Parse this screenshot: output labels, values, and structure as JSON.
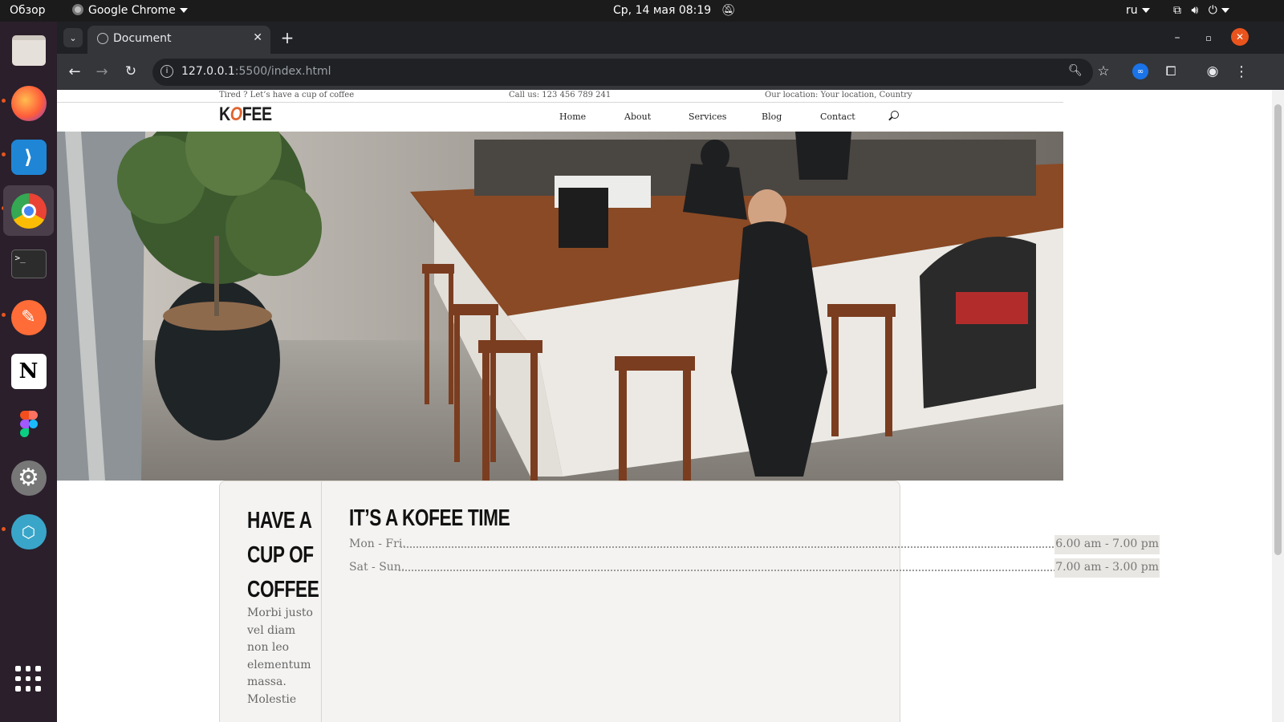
{
  "system": {
    "activities": "Обзор",
    "app_name": "Google Chrome",
    "datetime": "Ср, 14 мая  08:19",
    "lang": "ru"
  },
  "browser": {
    "tab_title": "Document",
    "url_host": "127.0.0.1",
    "url_rest": ":5500/index.html"
  },
  "dock": [
    {
      "name": "files",
      "icon": "folder-icon"
    },
    {
      "name": "firefox",
      "icon": "firefox-icon"
    },
    {
      "name": "vscode",
      "icon": "vscode-icon"
    },
    {
      "name": "chrome",
      "icon": "chrome-icon"
    },
    {
      "name": "terminal",
      "icon": "terminal-icon"
    },
    {
      "name": "postman",
      "icon": "postman-icon"
    },
    {
      "name": "notion",
      "icon": "notion-icon"
    },
    {
      "name": "figma",
      "icon": "figma-icon"
    },
    {
      "name": "settings",
      "icon": "gear-icon"
    },
    {
      "name": "software",
      "icon": "software-icon"
    }
  ],
  "site": {
    "info": {
      "tagline": "Tired ? Let’s have a cup of coffee",
      "phone": "Call us: 123 456 789 241",
      "location": "Our location: Your location, Country"
    },
    "logo": {
      "before": "K",
      "o": "O",
      "after": "FEE"
    },
    "nav": [
      "Home",
      "About",
      "Services",
      "Blog",
      "Contact"
    ],
    "card_left": {
      "title": "HAVE A CUP OF COFFEE",
      "text": "Morbi justo vel diam non leo elementum massa. Molestie"
    },
    "card_right": {
      "title": "IT’S A KOFEE TIME",
      "hours": [
        {
          "days": "Mon - Fri.",
          "time": "6.00 am - 7.00 pm"
        },
        {
          "days": "Sat - Sun.",
          "time": "7.00 am - 3.00 pm"
        }
      ]
    }
  },
  "colors": {
    "accent": "#e0632f",
    "card_bg": "#f4f3f1"
  }
}
